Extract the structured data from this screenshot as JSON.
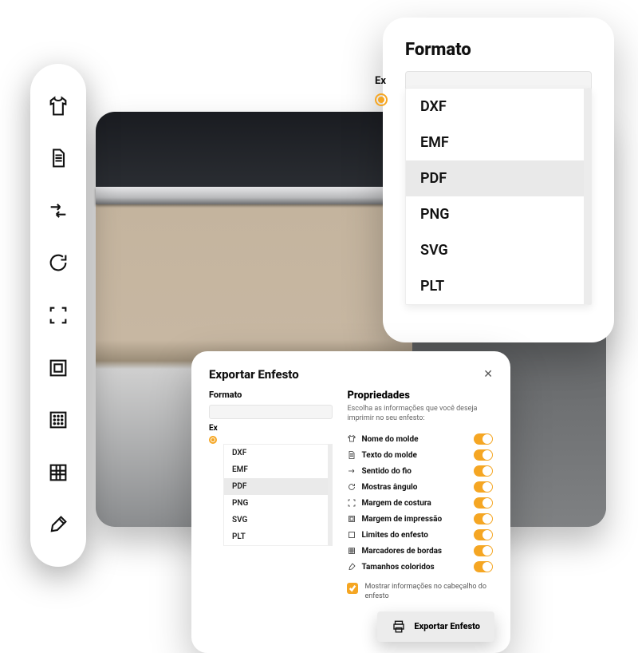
{
  "toolbar": {
    "items": [
      {
        "name": "shirt-icon"
      },
      {
        "name": "document-icon"
      },
      {
        "name": "arrows-collapse-icon"
      },
      {
        "name": "rotate-icon"
      },
      {
        "name": "frame-corners-icon"
      },
      {
        "name": "square-outline-icon"
      },
      {
        "name": "dotted-square-icon"
      },
      {
        "name": "grid-icon"
      },
      {
        "name": "brush-icon"
      }
    ]
  },
  "formato_large": {
    "title": "Formato",
    "peek_label": "Ex",
    "options": [
      "DXF",
      "EMF",
      "PDF",
      "PNG",
      "SVG",
      "PLT"
    ],
    "selected": "PDF"
  },
  "export_dialog": {
    "title": "Exportar Enfesto",
    "formato_label": "Formato",
    "peek_label": "Ex",
    "options": [
      "DXF",
      "EMF",
      "PDF",
      "PNG",
      "SVG",
      "PLT"
    ],
    "selected": "PDF",
    "properties_title": "Propriedades",
    "properties_subtitle": "Escolha as informações que você deseja imprimir no seu enfesto:",
    "props": [
      {
        "label": "Nome do molde",
        "icon": "shirt"
      },
      {
        "label": "Texto do molde",
        "icon": "doc"
      },
      {
        "label": "Sentido do fio",
        "icon": "arrow"
      },
      {
        "label": "Mostras ângulo",
        "icon": "rotate"
      },
      {
        "label": "Margem de costura",
        "icon": "frame"
      },
      {
        "label": "Margem de impressão",
        "icon": "square"
      },
      {
        "label": "Limites do enfesto",
        "icon": "dotted"
      },
      {
        "label": "Marcadores de bordas",
        "icon": "grid"
      },
      {
        "label": "Tamanhos coloridos",
        "icon": "brush"
      }
    ],
    "header_checkbox_label": "Mostrar informações no cabeçalho do enfesto",
    "export_button": "Exportar Enfesto"
  }
}
